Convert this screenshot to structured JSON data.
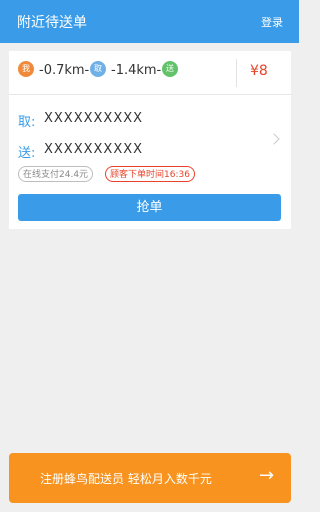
{
  "header": {
    "title": "附近待送单",
    "login": "登录"
  },
  "order": {
    "pins": {
      "me": "我",
      "take": "取",
      "send": "送"
    },
    "dist_me_to_take": "-0.7km-",
    "dist_take_to_send": "-1.4km-",
    "price": "¥8",
    "take_label": "取:",
    "take_value": "XXXXXXXXXX",
    "send_label": "送:",
    "send_value": "XXXXXXXXXX",
    "tags": {
      "payment": "在线支付24.4元",
      "order_time": "顾客下单时间16:36"
    },
    "grab_button": "抢单"
  },
  "bottom_banner": {
    "text": "注册蜂鸟配送员 轻松月入数千元",
    "arrow": "→"
  },
  "colors": {
    "primary": "#3a9ce8",
    "accent": "#f7931e",
    "price": "#e8432a"
  },
  "icons": [
    "pin-me-icon",
    "pin-take-icon",
    "pin-send-icon",
    "chevron-right-icon",
    "arrow-right-icon"
  ]
}
